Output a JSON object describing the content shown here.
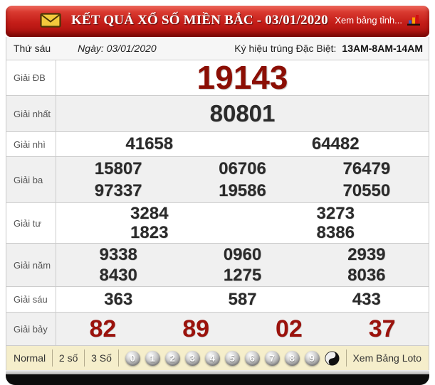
{
  "header": {
    "title": "KẾT QUẢ XỔ SỐ MIỀN BẮC - 03/01/2020",
    "link_label": "Xem bảng tỉnh...",
    "envelope_icon": "envelope-icon",
    "chart_icon": "bar-chart-icon"
  },
  "info": {
    "weekday": "Thứ sáu",
    "date": "Ngày: 03/01/2020",
    "special_symbol_label": "Ký hiệu trúng Đặc Biệt:",
    "special_symbol_value": "13AM-8AM-14AM"
  },
  "prizes": [
    {
      "label": "Giải ĐB",
      "rows": [
        [
          "19143"
        ]
      ]
    },
    {
      "label": "Giải nhất",
      "rows": [
        [
          "80801"
        ]
      ]
    },
    {
      "label": "Giải nhì",
      "rows": [
        [
          "41658",
          "64482"
        ]
      ]
    },
    {
      "label": "Giải ba",
      "rows": [
        [
          "15807",
          "06706",
          "76479"
        ],
        [
          "97337",
          "19586",
          "70550"
        ]
      ]
    },
    {
      "label": "Giải tư",
      "rows": [
        [
          "3284",
          "3273"
        ],
        [
          "1823",
          "8386"
        ]
      ]
    },
    {
      "label": "Giải năm",
      "rows": [
        [
          "9338",
          "0960",
          "2939"
        ],
        [
          "8430",
          "1275",
          "8036"
        ]
      ]
    },
    {
      "label": "Giải sáu",
      "rows": [
        [
          "363",
          "587",
          "433"
        ]
      ]
    },
    {
      "label": "Giải bảy",
      "rows": [
        [
          "82",
          "89",
          "02",
          "37"
        ]
      ]
    }
  ],
  "footer": {
    "modes": [
      "Normal",
      "2 số",
      "3 Số"
    ],
    "digit_balls": [
      "0",
      "1",
      "2",
      "3",
      "4",
      "5",
      "6",
      "7",
      "8",
      "9"
    ],
    "yin_yang_icon": "yin-yang-icon",
    "loto_link": "Xem Bảng Loto"
  },
  "colors": {
    "header_red": "#c41d18",
    "special_number_red": "#8b0e04",
    "seventh_number_red": "#9b120c",
    "number_dark": "#2b2b2b",
    "alt_row_bg": "#f0f0f0",
    "footer_bg": "#f5eecb",
    "envelope_yellow": "#f2c93c"
  }
}
